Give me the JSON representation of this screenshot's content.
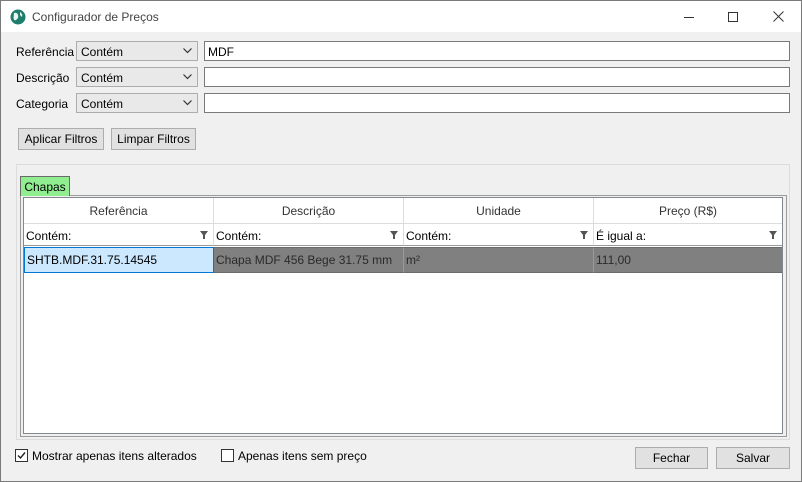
{
  "window": {
    "title": "Configurador de Preços",
    "icon": "globe-icon"
  },
  "filters": [
    {
      "label": "Referência",
      "operator": "Contém",
      "value": "MDF"
    },
    {
      "label": "Descrição",
      "operator": "Contém",
      "value": ""
    },
    {
      "label": "Categoria",
      "operator": "Contém",
      "value": ""
    }
  ],
  "buttons": {
    "apply": "Aplicar Filtros",
    "clear": "Limpar Filtros",
    "close": "Fechar",
    "save": "Salvar"
  },
  "tab": {
    "label": "Chapas",
    "color": "#90ee90"
  },
  "grid": {
    "columns": [
      "Referência",
      "Descrição",
      "Unidade",
      "Preço (R$)"
    ],
    "column_filters": [
      "Contém:",
      "Contém:",
      "Contém:",
      "É igual a:"
    ],
    "rows": [
      [
        "SHTB.MDF.31.75.14545",
        "Chapa MDF 456 Bege 31.75 mm",
        "m²",
        "111,00"
      ]
    ]
  },
  "options": {
    "only_changed": {
      "label": "Mostrar apenas itens alterados",
      "checked": true
    },
    "no_price": {
      "label": "Apenas itens sem preço",
      "checked": false
    }
  }
}
